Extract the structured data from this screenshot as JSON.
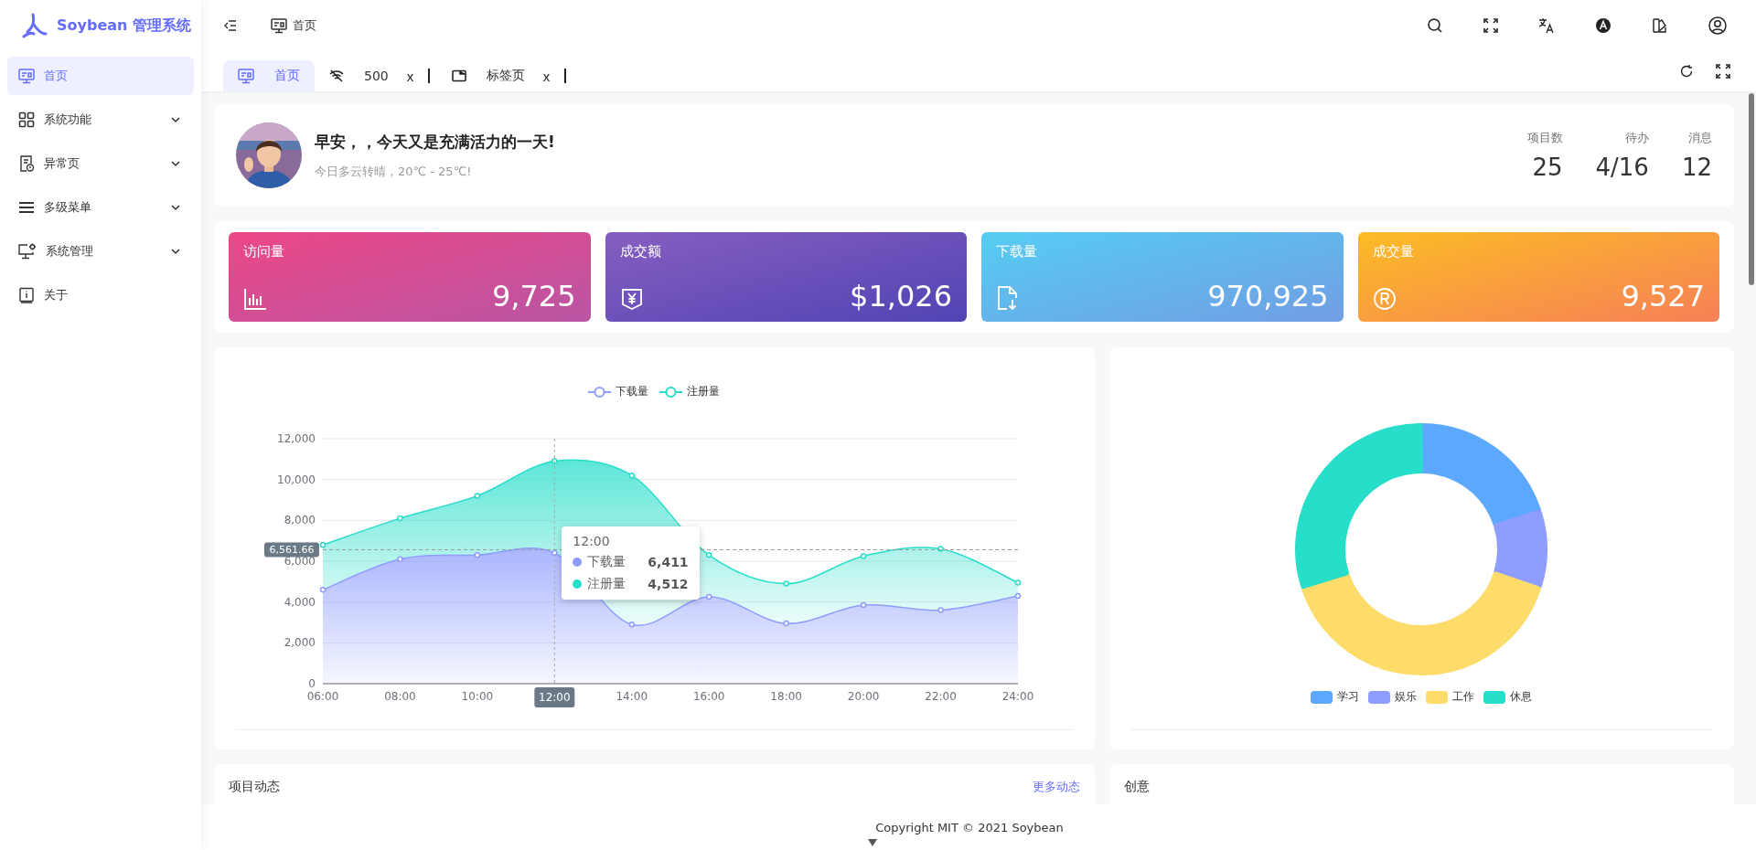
{
  "sidebar": {
    "app_name": "Soybean 管理系统",
    "items": [
      {
        "label": "首页",
        "selected": true
      },
      {
        "label": "系统功能",
        "selected": false,
        "expanded": false
      },
      {
        "label": "异常页",
        "selected": false,
        "expanded": false
      },
      {
        "label": "多级菜单",
        "selected": false,
        "expanded": false
      },
      {
        "label": "系统管理",
        "selected": false,
        "expanded": false
      },
      {
        "label": "关于",
        "selected": false
      }
    ]
  },
  "header": {
    "breadcrumb": "首页"
  },
  "tabs": [
    {
      "label": "首页",
      "selected": true
    },
    {
      "label": "500",
      "selected": false,
      "close": "x"
    },
    {
      "label": "标签页",
      "selected": false,
      "close": "x"
    }
  ],
  "greeting": {
    "title": "早安，，今天又是充满活力的一天!",
    "subtitle": "今日多云转晴，20℃ - 25℃!",
    "stats": [
      {
        "label": "项目数",
        "value": "25"
      },
      {
        "label": "待办",
        "value": "4/16"
      },
      {
        "label": "消息",
        "value": "12"
      }
    ]
  },
  "cards": [
    {
      "title": "访问量",
      "value": "9,725",
      "color": "#ec4786"
    },
    {
      "title": "成交额",
      "value": "$1,026",
      "color": "#865ec0"
    },
    {
      "title": "下载量",
      "value": "970,925",
      "color": "#56cdf3"
    },
    {
      "title": "成交量",
      "value": "9,527",
      "color": "#fcbc25"
    }
  ],
  "line_chart": {
    "chart_data": {
      "type": "area",
      "stacked": true,
      "grid": true,
      "legend": true,
      "x": [
        "06:00",
        "08:00",
        "10:00",
        "12:00",
        "14:00",
        "16:00",
        "18:00",
        "20:00",
        "22:00",
        "24:00"
      ],
      "series": [
        {
          "name": "下载量",
          "color": "#8e9dff",
          "values": [
            4600,
            6100,
            6300,
            6400,
            2900,
            4250,
            2950,
            3850,
            3600,
            4300
          ]
        },
        {
          "name": "注册量",
          "color": "#26deca",
          "values": [
            2200,
            2000,
            2900,
            4500,
            7300,
            2050,
            1950,
            2400,
            3000,
            650
          ]
        }
      ],
      "ylim": [
        0,
        12000
      ],
      "yticks": [
        {
          "value": 0,
          "label": "0"
        },
        {
          "value": 2000,
          "label": "2,000"
        },
        {
          "value": 4000,
          "label": "4,000"
        },
        {
          "value": 6000,
          "label": "6,000"
        },
        {
          "value": 8000,
          "label": "8,000"
        },
        {
          "value": 10000,
          "label": "10,000"
        },
        {
          "value": 12000,
          "label": "12,000"
        }
      ],
      "ref_lines": [
        {
          "axis": "y",
          "value": 6561.66,
          "label": "6,561.66"
        },
        {
          "axis": "x",
          "value": "12:00"
        }
      ]
    },
    "tooltip": {
      "title": "12:00",
      "rows": [
        {
          "label": "下载量",
          "value": "6,411",
          "color": "#8e9dff"
        },
        {
          "label": "注册量",
          "value": "4,512",
          "color": "#26deca"
        }
      ]
    }
  },
  "donut_chart": {
    "chart_data": {
      "type": "donut",
      "legend": true,
      "categories": [
        "学习",
        "娱乐",
        "工作",
        "休息"
      ],
      "values": [
        20,
        10,
        40,
        30
      ],
      "colors": [
        "#5da8ff",
        "#8e9dff",
        "#fedc69",
        "#26deca"
      ]
    }
  },
  "bottom_cards": [
    {
      "title": "项目动态",
      "link": "更多动态"
    },
    {
      "title": "创意"
    }
  ],
  "footer": "Copyright MIT © 2021 Soybean"
}
